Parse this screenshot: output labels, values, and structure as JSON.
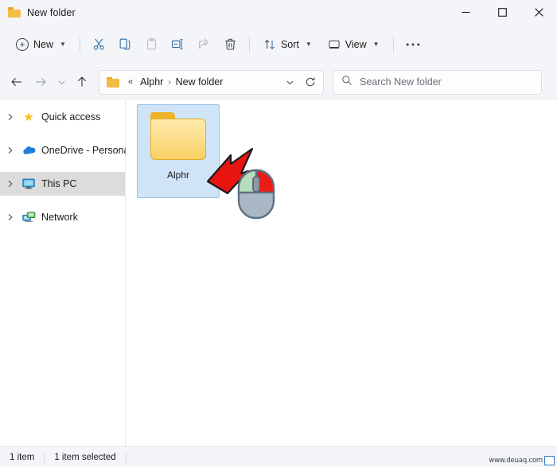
{
  "window": {
    "title": "New folder",
    "title_icon": "folder-icon",
    "controls": {
      "minimize": "minimize-icon",
      "maximize": "maximize-icon",
      "close": "close-icon"
    }
  },
  "toolbar": {
    "new_label": "New",
    "new_icon": "plus-circle-icon",
    "new_chevron": "chevron-down-icon",
    "cut_icon": "scissors-icon",
    "copy_icon": "copy-icon",
    "paste_icon": "clipboard-paste-icon",
    "rename_icon": "rename-icon",
    "share_icon": "share-icon",
    "delete_icon": "trash-icon",
    "sort_label": "Sort",
    "sort_icon": "sort-arrows-icon",
    "view_label": "View",
    "view_icon": "view-monitor-icon",
    "more_label": "•••",
    "more_icon": "ellipsis-icon"
  },
  "navigation": {
    "back_icon": "arrow-left-icon",
    "forward_icon": "arrow-right-icon",
    "recent_icon": "chevron-down-icon",
    "up_icon": "arrow-up-icon",
    "refresh_icon": "refresh-icon",
    "address_chevron": "chevron-down-icon",
    "breadcrumb_icon": "folder-icon",
    "breadcrumb_overflow": "«",
    "breadcrumb": [
      {
        "label": "Alphr"
      },
      {
        "label": "New folder"
      }
    ],
    "separator": "›"
  },
  "search": {
    "placeholder": "Search New folder",
    "icon": "search-icon",
    "value": ""
  },
  "sidebar": {
    "items": [
      {
        "label": "Quick access",
        "icon": "star-icon",
        "expander": "chevron-right-icon",
        "selected": false
      },
      {
        "label": "OneDrive - Personal",
        "icon": "cloud-icon",
        "expander": "chevron-right-icon",
        "selected": false
      },
      {
        "label": "This PC",
        "icon": "monitor-icon",
        "expander": "chevron-right-icon",
        "selected": true
      },
      {
        "label": "Network",
        "icon": "network-icon",
        "expander": "chevron-right-icon",
        "selected": false
      }
    ]
  },
  "content": {
    "files": [
      {
        "name": "Alphr",
        "type": "folder",
        "selected": true,
        "icon": "folder-icon"
      }
    ],
    "annotations": {
      "cursor_arrow": {
        "name": "red-arrow-cursor",
        "color": "#e8140f",
        "direction": "up-left"
      },
      "mouse": {
        "name": "mouse-right-click-illustration",
        "left_button_color": "#b6ddbd",
        "right_button_color": "#ee1c16",
        "wheel_color": "#8e9aa8",
        "body_color": "#aab8c6"
      }
    }
  },
  "statusbar": {
    "item_count": "1 item",
    "selection": "1 item selected"
  },
  "watermark": {
    "text": "www.deuaq.com",
    "icon": "monitor-icon"
  },
  "colors": {
    "chrome": "#f3f5f8",
    "accent": "#1b4f84",
    "selection_fill": "#cfe4f7",
    "selection_border": "#9ac4e8",
    "sidebar_selected": "#dcdcdc",
    "folder_yellow": "#f3bc45",
    "arrow_red": "#e8140f"
  }
}
